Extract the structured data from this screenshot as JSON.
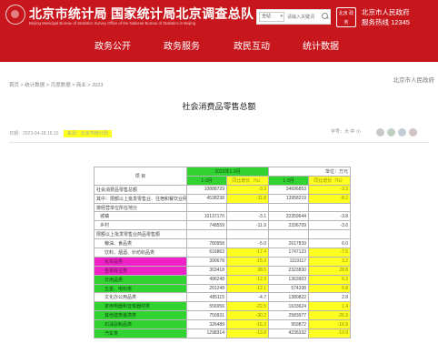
{
  "header": {
    "site_title": "北京市统计局 国家统计局北京调查总队",
    "site_subtitle": "Beijing Municipal Bureau of Statistics  Survey Office of the National Bureau of Statistics in Beijing",
    "search": {
      "scope": "全站",
      "placeholder": "请输入关键词"
    },
    "gov_badge": "北京\n政务",
    "gov_name": "北京市人民政府",
    "hotline": "服务热线 12345"
  },
  "nav": [
    "政务公开",
    "政务服务",
    "政民互动",
    "统计数据"
  ],
  "page": {
    "right_note": "北京市人民政府",
    "breadcrumb": [
      "首页",
      "统计数据",
      "月度数据",
      "商业",
      "2023"
    ],
    "title": "社会消费品零售总额",
    "meta": {
      "date": "日期：2023-04-18 16:15",
      "source_label": "来源：",
      "source": "北京市统计局"
    },
    "font_size_label": "字号：大 中 小"
  },
  "table": {
    "unit": "单位：万元",
    "period": "2023年1-3月",
    "headers": [
      "项 目",
      "1-3月",
      "同比增长（%）",
      "1-3月",
      "同比增长（%）"
    ],
    "rows": [
      {
        "label": "社会消费品零售总额",
        "indent": 0,
        "v1": "10888729",
        "g1": "-3.3",
        "v2": "34696853",
        "g2": "-3.3"
      },
      {
        "label": "其中：限额以上批发零售业、住宿和餐饮业网上零售额",
        "indent": 0,
        "v1": "4538238",
        "g1": "-11.8",
        "v2": "13958219",
        "g2": "-8.2"
      },
      {
        "label": "按经营单位所在地分",
        "indent": 0,
        "v1": "",
        "g1": "",
        "v2": "",
        "g2": ""
      },
      {
        "label": "城镇",
        "indent": 1,
        "v1": "10137170",
        "g1": "-3.1",
        "v2": "32359644",
        "g2": "-3.8"
      },
      {
        "label": "乡村",
        "indent": 1,
        "v1": "748559",
        "g1": "-11.9",
        "v2": "2336709",
        "g2": "-3.6"
      },
      {
        "label": "限额以上批发零售业商品零售额",
        "indent": 0,
        "v1": "",
        "g1": "",
        "v2": "",
        "g2": ""
      },
      {
        "label": "粮油、食品类",
        "indent": 2,
        "v1": "780958",
        "g1": "-5.0",
        "v2": "2617839",
        "g2": "6.0"
      },
      {
        "label": "饮料、烟酒、针纺织品类",
        "indent": 2,
        "v1": "616863",
        "g1": "-17.4",
        "v2": "1747123",
        "g2": "-7.5"
      },
      {
        "label": "化妆品类",
        "indent": 2,
        "v1": "390678",
        "g1": "-15.3",
        "v2": "1119117",
        "g2": "3.2"
      },
      {
        "label": "金银珠宝类",
        "indent": 2,
        "v1": "303418",
        "g1": "38.5",
        "v2": "2323830",
        "g2": "28.8"
      },
      {
        "label": "日用品类",
        "indent": 2,
        "v1": "496248",
        "g1": "-12.3",
        "v2": "1363903",
        "g2": "6.3"
      },
      {
        "label": "五金、电料类",
        "indent": 2,
        "v1": "201248",
        "g1": "-12.1",
        "v2": "574338",
        "g2": "6.8"
      },
      {
        "label": "文化办公用品类",
        "indent": 2,
        "v1": "485115",
        "g1": "-4.7",
        "v2": "1380822",
        "g2": "2.8"
      },
      {
        "label": "家用电器和音像器材类",
        "indent": 2,
        "v1": "556956",
        "g1": "-22.5",
        "v2": "1633624",
        "g2": "1.4"
      },
      {
        "label": "其他建筑装潢类",
        "indent": 2,
        "v1": "750931",
        "g1": "-30.2",
        "v2": "2583977",
        "g2": "-26.9"
      },
      {
        "label": "石油及制品类",
        "indent": 2,
        "v1": "326489",
        "g1": "-16.2",
        "v2": "959872",
        "g2": "-16.9"
      },
      {
        "label": "汽车类",
        "indent": 2,
        "v1": "1298314",
        "g1": "-13.8",
        "v2": "4236332",
        "g2": "-10.9"
      }
    ]
  },
  "highlight_colors": {
    "green": "#31d331",
    "yellow": "#ffff22",
    "magenta": "#ee22c6",
    "brand_red": "#c8161d"
  }
}
